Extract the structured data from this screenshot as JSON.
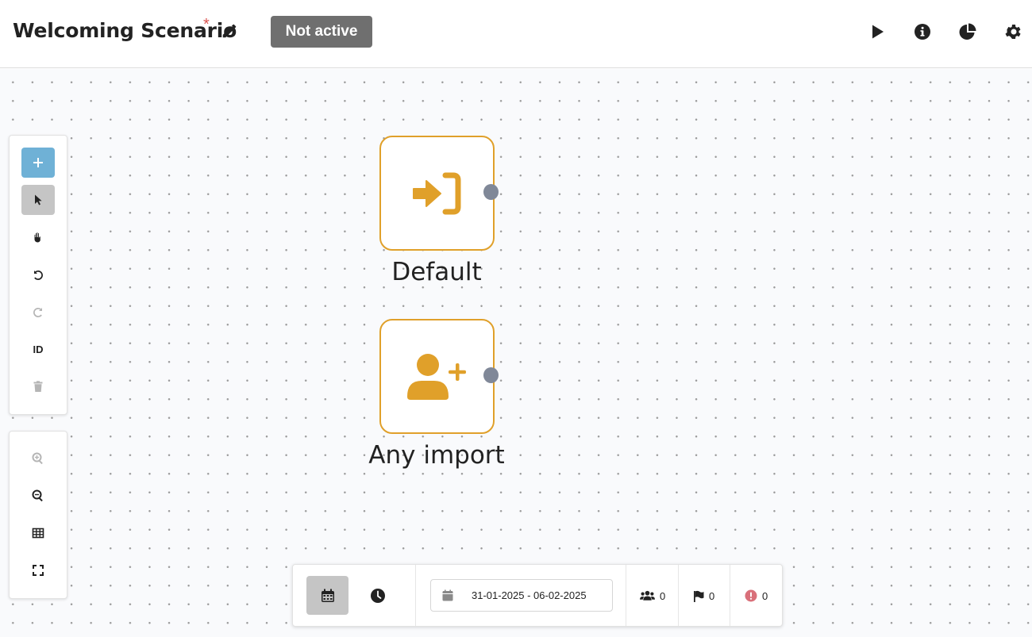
{
  "header": {
    "title": "Welcoming Scenario",
    "unsaved_marker": "*",
    "status": "Not active",
    "actions": {
      "run_icon": "play-icon",
      "info_icon": "info-circle-icon",
      "stats_icon": "pie-chart-icon",
      "settings_icon": "gear-icon"
    }
  },
  "toolbar": {
    "tools": [
      "plus-icon",
      "pointer-icon",
      "hand-icon",
      "undo-icon",
      "redo-icon",
      "id-toggle",
      "trash-icon"
    ],
    "id_label": "ID",
    "active_tool": "pointer",
    "view_tools": [
      "zoom-in-icon",
      "zoom-out-icon",
      "grid-icon",
      "fit-screen-icon"
    ]
  },
  "nodes": [
    {
      "label": "Default",
      "icon": "sign-in-icon"
    },
    {
      "label": "Any import",
      "icon": "user-plus-icon"
    }
  ],
  "stats_bar": {
    "date_range": "31-01-2025 - 06-02-2025",
    "contacts_count": "0",
    "goals_count": "0",
    "errors_count": "0"
  },
  "colors": {
    "accent_node": "#e0a02a",
    "add_button": "#6fb1d6",
    "status_badge": "#6f6f6f",
    "error": "#d9534f",
    "port": "#808898"
  }
}
